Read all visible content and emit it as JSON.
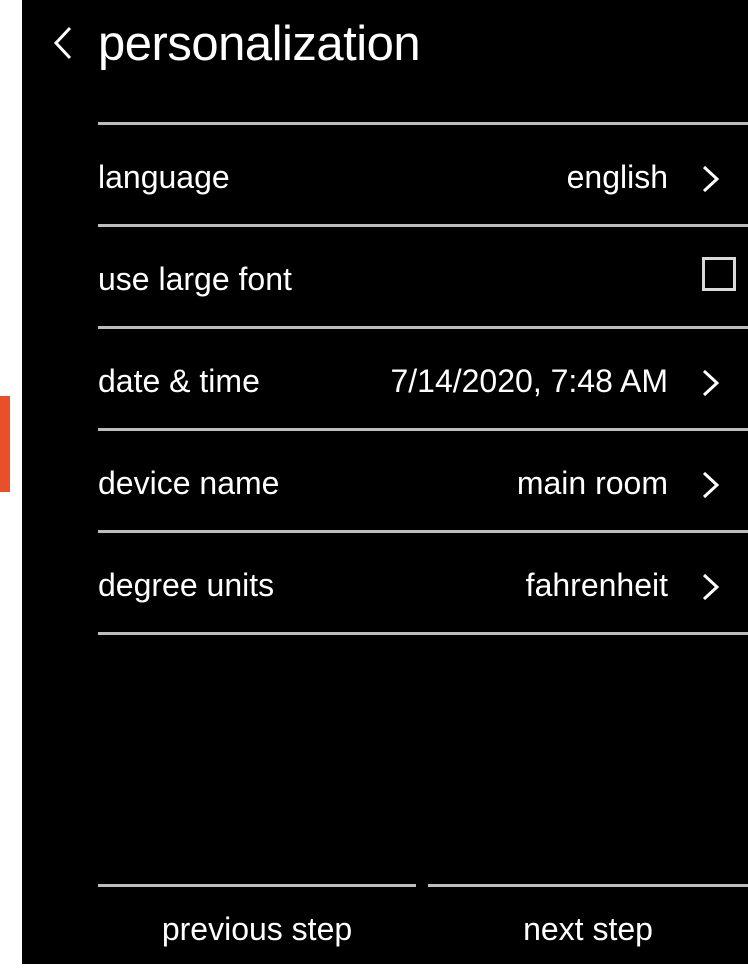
{
  "header": {
    "title": "personalization",
    "back_icon": "chevron-left-icon"
  },
  "settings": [
    {
      "label": "language",
      "value": "english",
      "control": "chevron"
    },
    {
      "label": "use large font",
      "value": "",
      "control": "checkbox",
      "checked": false
    },
    {
      "label": "date & time",
      "value": "7/14/2020, 7:48 AM",
      "control": "chevron"
    },
    {
      "label": "device name",
      "value": "main room",
      "control": "chevron"
    },
    {
      "label": "degree units",
      "value": "fahrenheit",
      "control": "chevron"
    }
  ],
  "footer": {
    "previous_label": "previous step",
    "next_label": "next step"
  },
  "colors": {
    "background": "#000000",
    "text": "#ffffff",
    "divider": "#bdbdbd",
    "accent": "#e9502a"
  }
}
